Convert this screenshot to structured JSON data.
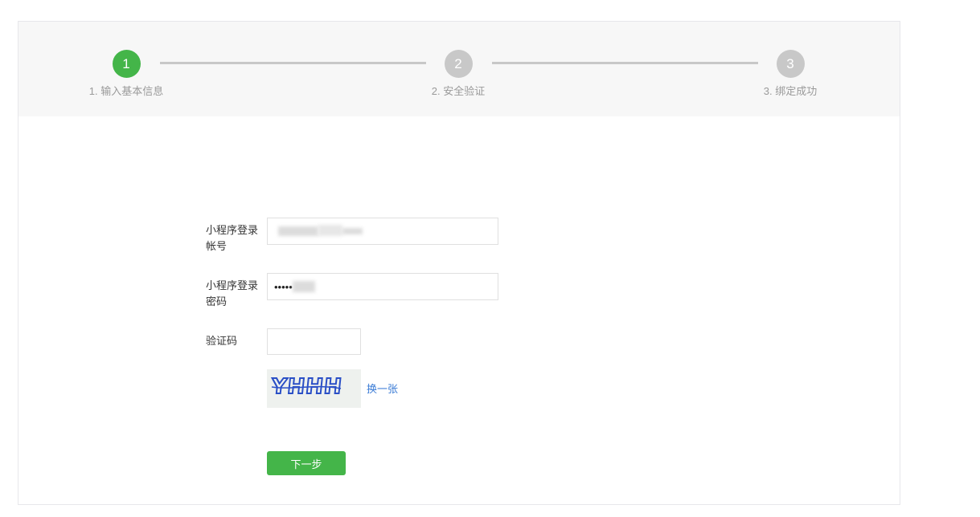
{
  "steps": [
    {
      "number": "1",
      "label": "1. 输入基本信息",
      "state": "active"
    },
    {
      "number": "2",
      "label": "2. 安全验证",
      "state": "inactive"
    },
    {
      "number": "3",
      "label": "3. 绑定成功",
      "state": "inactive"
    }
  ],
  "colors": {
    "accent": "#44b549",
    "inactive": "#c8c8c8",
    "link": "#3a7bd5"
  },
  "form": {
    "account_label_line1": "小程序登录",
    "account_label_line2": "帐号",
    "account_value": "",
    "password_label_line1": "小程序登录",
    "password_label_line2": "密码",
    "password_value": "•••••",
    "captcha_label": "验证码",
    "captcha_value": "",
    "captcha_image_text": "YHHH",
    "change_captcha": "换一张",
    "next_button": "下一步"
  }
}
